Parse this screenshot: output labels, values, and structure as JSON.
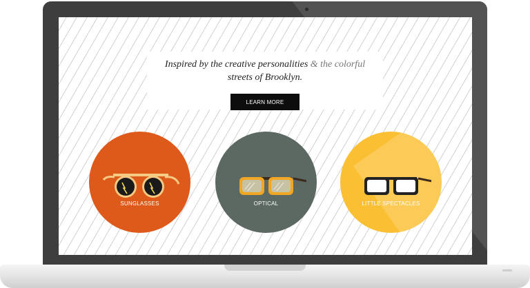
{
  "hero": {
    "tagline_part1": "Inspired by the creative personalities ",
    "tagline_part2": "& the colorful",
    "tagline_part3": "streets of Brooklyn.",
    "cta_label": "LEARN MORE"
  },
  "categories": [
    {
      "label": "SUNGLASSES",
      "color": "#de5a1a",
      "icon": "sunglasses-icon"
    },
    {
      "label": "OPTICAL",
      "color": "#5c6962",
      "icon": "optical-glasses-icon"
    },
    {
      "label": "LITTLE SPECTACLES",
      "color": "#fbbf33",
      "icon": "spectacles-icon"
    }
  ]
}
